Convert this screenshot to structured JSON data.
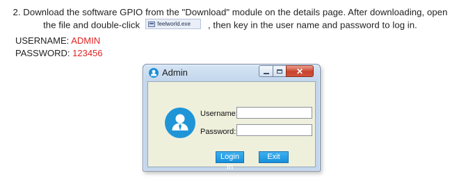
{
  "instructions": {
    "step_before_chip": "2. Download the software GPIO from the \"Download\" module on the details page. After downloading, open the file and double-click",
    "file_chip_label": "feelworld.exe",
    "step_after_chip": ", then key in the user name and password to log in.",
    "username_label": "USERNAME:",
    "username_value": "ADMIN",
    "password_label": "PASSWORD:",
    "password_value": "123456",
    "value_color": "#e02222"
  },
  "dialog": {
    "title": "Admin",
    "close_glyph": "✕",
    "username_label": "Username:",
    "username_value": "",
    "password_label": "Password:",
    "password_value": "",
    "login_button": "Login In",
    "exit_button": "Exit",
    "accent_color": "#1f95d8",
    "client_bg": "#eef0dc"
  }
}
